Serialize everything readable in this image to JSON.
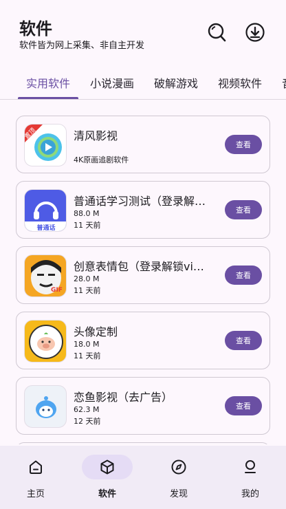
{
  "header": {
    "title": "软件",
    "subtitle": "软件皆为网上采集、非自主开发",
    "search_icon": "search-icon",
    "download_icon": "download-icon"
  },
  "tabs": [
    {
      "label": "实用软件",
      "active": true
    },
    {
      "label": "小说漫画",
      "active": false
    },
    {
      "label": "破解游戏",
      "active": false
    },
    {
      "label": "视频软件",
      "active": false
    },
    {
      "label": "音",
      "active": false
    }
  ],
  "apps": [
    {
      "name": "清风影视",
      "line1": "",
      "line2": "4K原画追剧软件",
      "badge": "置顶",
      "button": "查看"
    },
    {
      "name": "普通话学习测试（登录解…",
      "line1": "88.0 M",
      "line2": "11 天前",
      "icon_text": "普通话",
      "button": "查看"
    },
    {
      "name": "创意表情包（登录解锁vip…",
      "line1": "28.0 M",
      "line2": "11 天前",
      "icon_text": "GIF",
      "button": "查看"
    },
    {
      "name": "头像定制",
      "line1": "18.0 M",
      "line2": "11 天前",
      "button": "查看"
    },
    {
      "name": "恋鱼影视（去广告）",
      "line1": "62.3 M",
      "line2": "12 天前",
      "button": "查看"
    }
  ],
  "nav": [
    {
      "label": "主页",
      "icon": "home-icon",
      "active": false
    },
    {
      "label": "软件",
      "icon": "apps-icon",
      "active": true
    },
    {
      "label": "发现",
      "icon": "compass-icon",
      "active": false
    },
    {
      "label": "我的",
      "icon": "person-icon",
      "active": false
    }
  ],
  "colors": {
    "accent": "#6a4fa3",
    "background": "#fdf7fd",
    "nav_background": "#f1ebf6"
  }
}
